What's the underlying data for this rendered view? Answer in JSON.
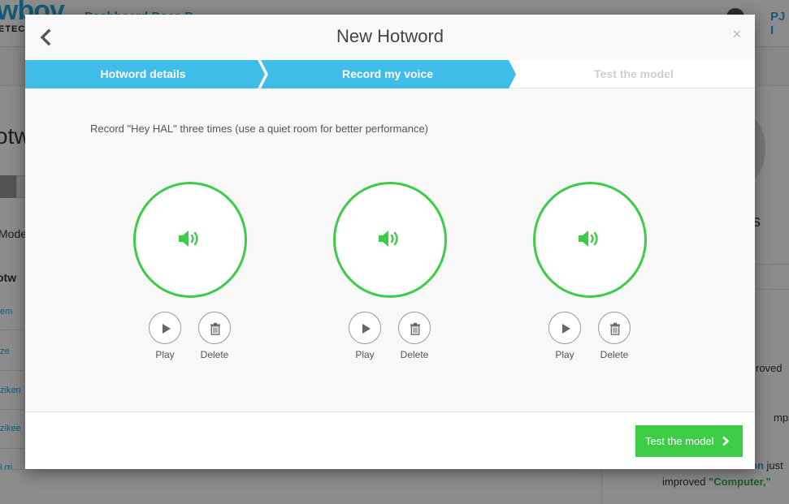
{
  "background": {
    "logo": "wbov",
    "logo_sub": "ETEC",
    "nav": "Dashboard   Docs   P",
    "user": "PJ I",
    "title": "otw",
    "mode_label": "Mode",
    "hotwords_label": "otw",
    "rows": [
      "em",
      "ze",
      "ziken",
      "zikee",
      "i ơi"
    ],
    "right_letter": "s",
    "feed": [
      {
        "text": "roved"
      },
      {
        "text": "mprove"
      },
      {
        "name": "on",
        "suffix": " just"
      },
      {
        "prefix": "improved ",
        "word": "\"Computer,\""
      }
    ]
  },
  "modal": {
    "title": "New Hotword",
    "back_icon": "chevron-left-icon",
    "close_symbol": "×",
    "steps": [
      {
        "label": "Hotword details",
        "state": "completed"
      },
      {
        "label": "Record my voice",
        "state": "active"
      },
      {
        "label": "Test the model",
        "state": "pending"
      }
    ],
    "step_color_active": "#3ebde8",
    "instruction": "Record \"Hey HAL\" three times (use a quiet room for better performance)",
    "recordings": [
      {
        "icon": "speaker-icon",
        "play_label": "Play",
        "delete_label": "Delete"
      },
      {
        "icon": "speaker-icon",
        "play_label": "Play",
        "delete_label": "Delete"
      },
      {
        "icon": "speaker-icon",
        "play_label": "Play",
        "delete_label": "Delete"
      }
    ],
    "accent_color": "#3ccc46",
    "next_button_label": "Test the model"
  }
}
